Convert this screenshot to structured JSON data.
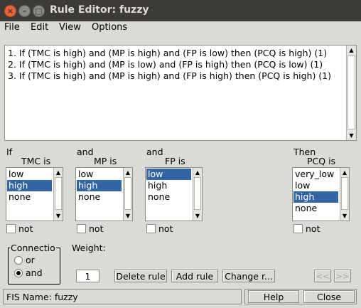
{
  "window": {
    "title": "Rule Editor: fuzzy"
  },
  "menu": [
    "File",
    "Edit",
    "View",
    "Options"
  ],
  "rules": [
    "1. If (TMC is high) and (MP is high) and (FP is low) then (PCQ is high) (1)",
    "2. If (TMC is high) and (MP is low) and (FP is high) then (PCQ is low) (1)",
    "3. If (TMC is high) and (MP is high) and (FP is high) then (PCQ is high) (1)"
  ],
  "columns": [
    {
      "header": "If",
      "var_label": "TMC is",
      "options": [
        "low",
        "high",
        "none"
      ],
      "selected": "high",
      "not_label": "not"
    },
    {
      "header": "and",
      "var_label": "MP is",
      "options": [
        "low",
        "high",
        "none"
      ],
      "selected": "high",
      "not_label": "not"
    },
    {
      "header": "and",
      "var_label": "FP is",
      "options": [
        "low",
        "high",
        "none"
      ],
      "selected": "low",
      "not_label": "not"
    },
    {
      "header": "Then",
      "var_label": "PCQ is",
      "options": [
        "very_low",
        "low",
        "high",
        "none"
      ],
      "selected": "high",
      "not_label": "not"
    }
  ],
  "connection": {
    "label": "Connectio",
    "options": [
      "or",
      "and"
    ],
    "selected": "and"
  },
  "weight": {
    "label": "Weight:",
    "value": "1"
  },
  "buttons": {
    "delete": "Delete rule",
    "add": "Add rule",
    "change": "Change r...",
    "prev": "<<",
    "next": ">>"
  },
  "status": {
    "text": "FIS Name: fuzzy"
  },
  "bottom": {
    "help": "Help",
    "close": "Close"
  }
}
